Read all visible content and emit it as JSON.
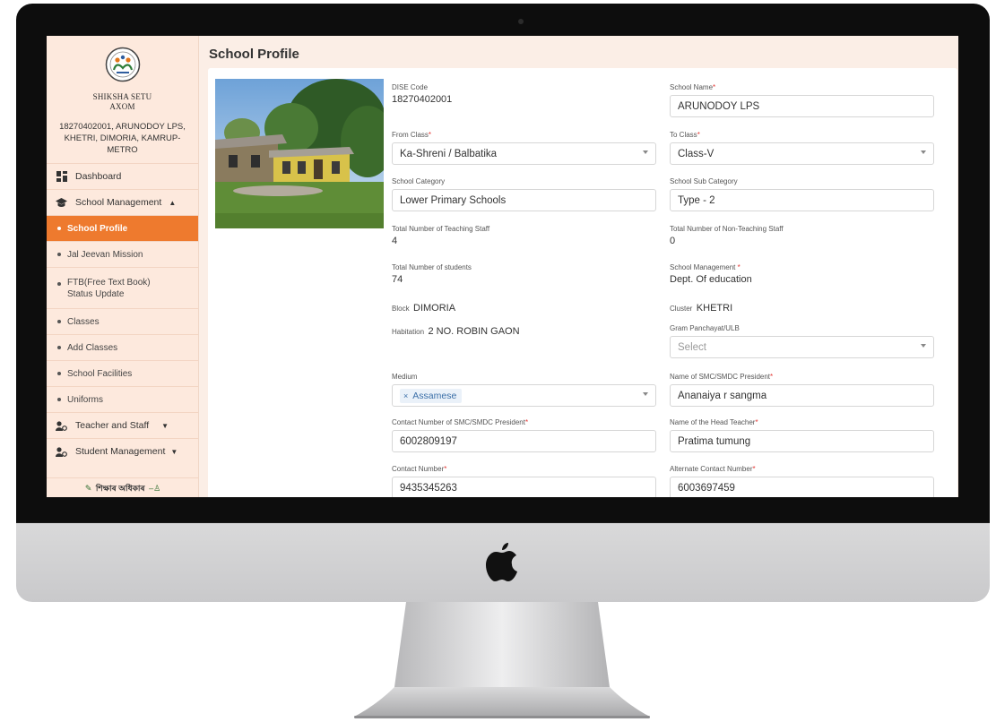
{
  "sidebar": {
    "logo_line1": "SHIKSHA SETU",
    "logo_line2": "AXOM",
    "school_id": "18270402001, ARUNODOY LPS, KHETRI, DIMORIA, KAMRUP-METRO",
    "menu": {
      "dashboard": "Dashboard",
      "school_management": "School Management",
      "school_profile": "School Profile",
      "jal_jeevan": "Jal Jeevan Mission",
      "ftb": "FTB(Free Text Book) Status Update",
      "classes": "Classes",
      "add_classes": "Add Classes",
      "school_facilities": "School Facilities",
      "uniforms": "Uniforms",
      "teacher_staff": "Teacher and Staff",
      "student_management": "Student Management"
    },
    "bottom_text": "শিক্ষাৰ অধিকাৰ"
  },
  "page": {
    "title": "School Profile"
  },
  "form": {
    "dise_code": {
      "label": "DISE Code",
      "value": "18270402001"
    },
    "school_name": {
      "label": "School Name",
      "value": "ARUNODOY LPS"
    },
    "from_class": {
      "label": "From Class",
      "value": "Ka-Shreni / Balbatika"
    },
    "to_class": {
      "label": "To Class",
      "value": "Class-V"
    },
    "school_category": {
      "label": "School Category",
      "value": "Lower Primary Schools"
    },
    "school_sub_category": {
      "label": "School Sub Category",
      "value": "Type - 2"
    },
    "teaching_staff": {
      "label": "Total Number of Teaching Staff",
      "value": "4"
    },
    "non_teaching_staff": {
      "label": "Total Number of Non-Teaching Staff",
      "value": "0"
    },
    "students": {
      "label": "Total Number of students",
      "value": "74"
    },
    "school_management": {
      "label": "School Management",
      "value": "Dept. Of education"
    },
    "block": {
      "label": "Block",
      "value": "DIMORIA"
    },
    "cluster": {
      "label": "Cluster",
      "value": "KHETRI"
    },
    "habitation": {
      "label": "Habitation",
      "value": "2 NO. ROBIN GAON"
    },
    "gram_panchayat": {
      "label": "Gram Panchayat/ULB",
      "placeholder": "Select"
    },
    "medium": {
      "label": "Medium",
      "value": "Assamese"
    },
    "smc_president": {
      "label": "Name of SMC/SMDC President",
      "value": "Ananaiya r sangma"
    },
    "smc_contact": {
      "label": "Contact Number of SMC/SMDC President",
      "value": "6002809197"
    },
    "head_teacher": {
      "label": "Name of the Head Teacher",
      "value": "Pratima tumung"
    },
    "contact_number": {
      "label": "Contact Number",
      "value": "9435345263"
    },
    "alt_contact": {
      "label": "Alternate Contact Number",
      "value": "6003697459"
    }
  }
}
